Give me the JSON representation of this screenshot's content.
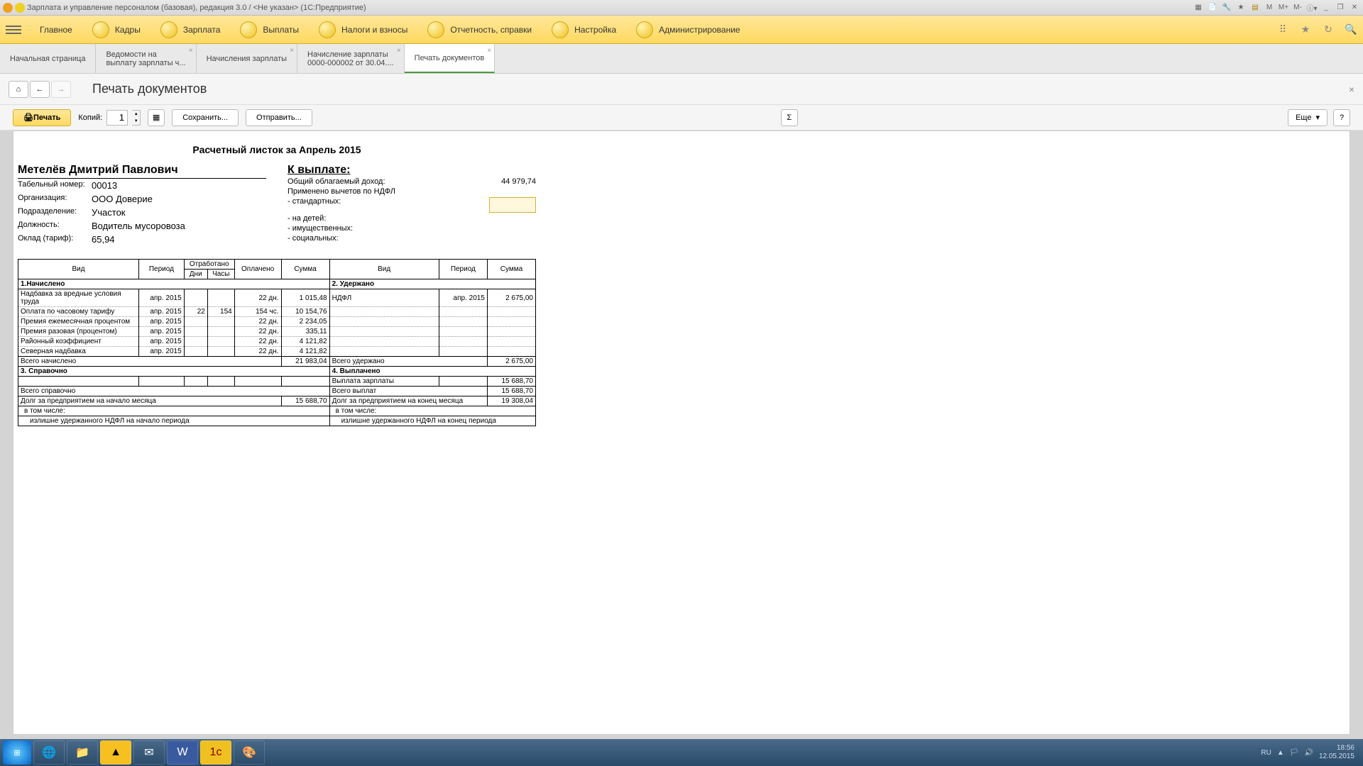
{
  "window": {
    "title": "Зарплата и управление персоналом (базовая), редакция 3.0 / <Не указан>  (1С:Предприятие)"
  },
  "nav": {
    "items": [
      "Главное",
      "Кадры",
      "Зарплата",
      "Выплаты",
      "Налоги и взносы",
      "Отчетность, справки",
      "Настройка",
      "Администрирование"
    ]
  },
  "tabs": [
    {
      "label": "Начальная страница",
      "closable": false
    },
    {
      "label": "Ведомости на",
      "sub": "выплату зарплаты ч...",
      "closable": true
    },
    {
      "label": "Начисления зарплаты",
      "closable": true
    },
    {
      "label": "Начисление зарплаты",
      "sub": "0000-000002 от 30.04....",
      "closable": true
    },
    {
      "label": "Печать документов",
      "closable": true,
      "active": true
    }
  ],
  "page": {
    "title": "Печать документов"
  },
  "toolbar": {
    "print": "Печать",
    "copies_label": "Копий:",
    "copies_value": "1",
    "save": "Сохранить...",
    "send": "Отправить...",
    "sigma": "Σ",
    "more": "Еще",
    "help": "?"
  },
  "doc": {
    "title": "Расчетный листок за Апрель 2015",
    "employee": {
      "name": "Метелёв Дмитрий Павлович",
      "fields": [
        {
          "label": "Табельный номер:",
          "value": "00013"
        },
        {
          "label": "Организация:",
          "value": "ООО Доверие"
        },
        {
          "label": "Подразделение:",
          "value": "Участок"
        },
        {
          "label": "Должность:",
          "value": "Водитель мусоровоза"
        },
        {
          "label": "Оклад (тариф):",
          "value": "65,94"
        }
      ]
    },
    "right_block": {
      "title": "К выплате:",
      "income": {
        "label": "Общий облагаемый доход:",
        "value": "44 979,74"
      },
      "deduct_title": "Применено вычетов по НДФЛ",
      "lines": [
        "- стандартных:",
        "- на детей:",
        "- имущественных:",
        "- социальных:"
      ]
    },
    "headers": {
      "vid": "Вид",
      "period": "Период",
      "worked": "Отработано",
      "days": "Дни",
      "hours": "Часы",
      "paid": "Оплачено",
      "sum": "Сумма"
    },
    "sections": {
      "s1": "1.Начислено",
      "s2": "2. Удержано",
      "s3": "3. Справочно",
      "s4": "4. Выплачено",
      "tot_accr": "Всего начислено",
      "tot_ded": "Всего удержано",
      "tot_ref": "Всего справочно",
      "tot_paid": "Всего выплат",
      "debt_start": "Долг за предприятием на начало месяца",
      "debt_end": "Долг за предприятием на конец месяца",
      "incl": "в том числе:",
      "ndfl_start": "излишне удержанного НДФЛ на начало периода",
      "ndfl_end": "излишне удержанного НДФЛ на конец периода"
    },
    "accrued": [
      {
        "vid": "Надбавка за вредные условия труда",
        "period": "апр. 2015",
        "days": "",
        "hours": "",
        "paid": "22 дн.",
        "sum": "1 015,48"
      },
      {
        "vid": "Оплата по часовому тарифу",
        "period": "апр. 2015",
        "days": "22",
        "hours": "154",
        "paid": "154 чс.",
        "sum": "10 154,76"
      },
      {
        "vid": "Премия ежемесячная процентом",
        "period": "апр. 2015",
        "days": "",
        "hours": "",
        "paid": "22 дн.",
        "sum": "2 234,05"
      },
      {
        "vid": "Премия разовая (процентом)",
        "period": "апр. 2015",
        "days": "",
        "hours": "",
        "paid": "22 дн.",
        "sum": "335,11"
      },
      {
        "vid": "Районный коэффициент",
        "period": "апр. 2015",
        "days": "",
        "hours": "",
        "paid": "22 дн.",
        "sum": "4 121,82"
      },
      {
        "vid": "Северная надбавка",
        "period": "апр. 2015",
        "days": "",
        "hours": "",
        "paid": "22 дн.",
        "sum": "4 121,82"
      }
    ],
    "accrued_total": "21 983,04",
    "deductions": [
      {
        "vid": "НДФЛ",
        "period": "апр. 2015",
        "sum": "2 675,00"
      }
    ],
    "deductions_total": "2 675,00",
    "paid": [
      {
        "vid": "Выплата зарплаты",
        "sum": "15 688,70"
      }
    ],
    "paid_total": "15 688,70",
    "debt_start_val": "15 688,70",
    "debt_end_val": "19 308,04"
  },
  "tray": {
    "lang": "RU",
    "time": "18:56",
    "date": "12.05.2015"
  }
}
